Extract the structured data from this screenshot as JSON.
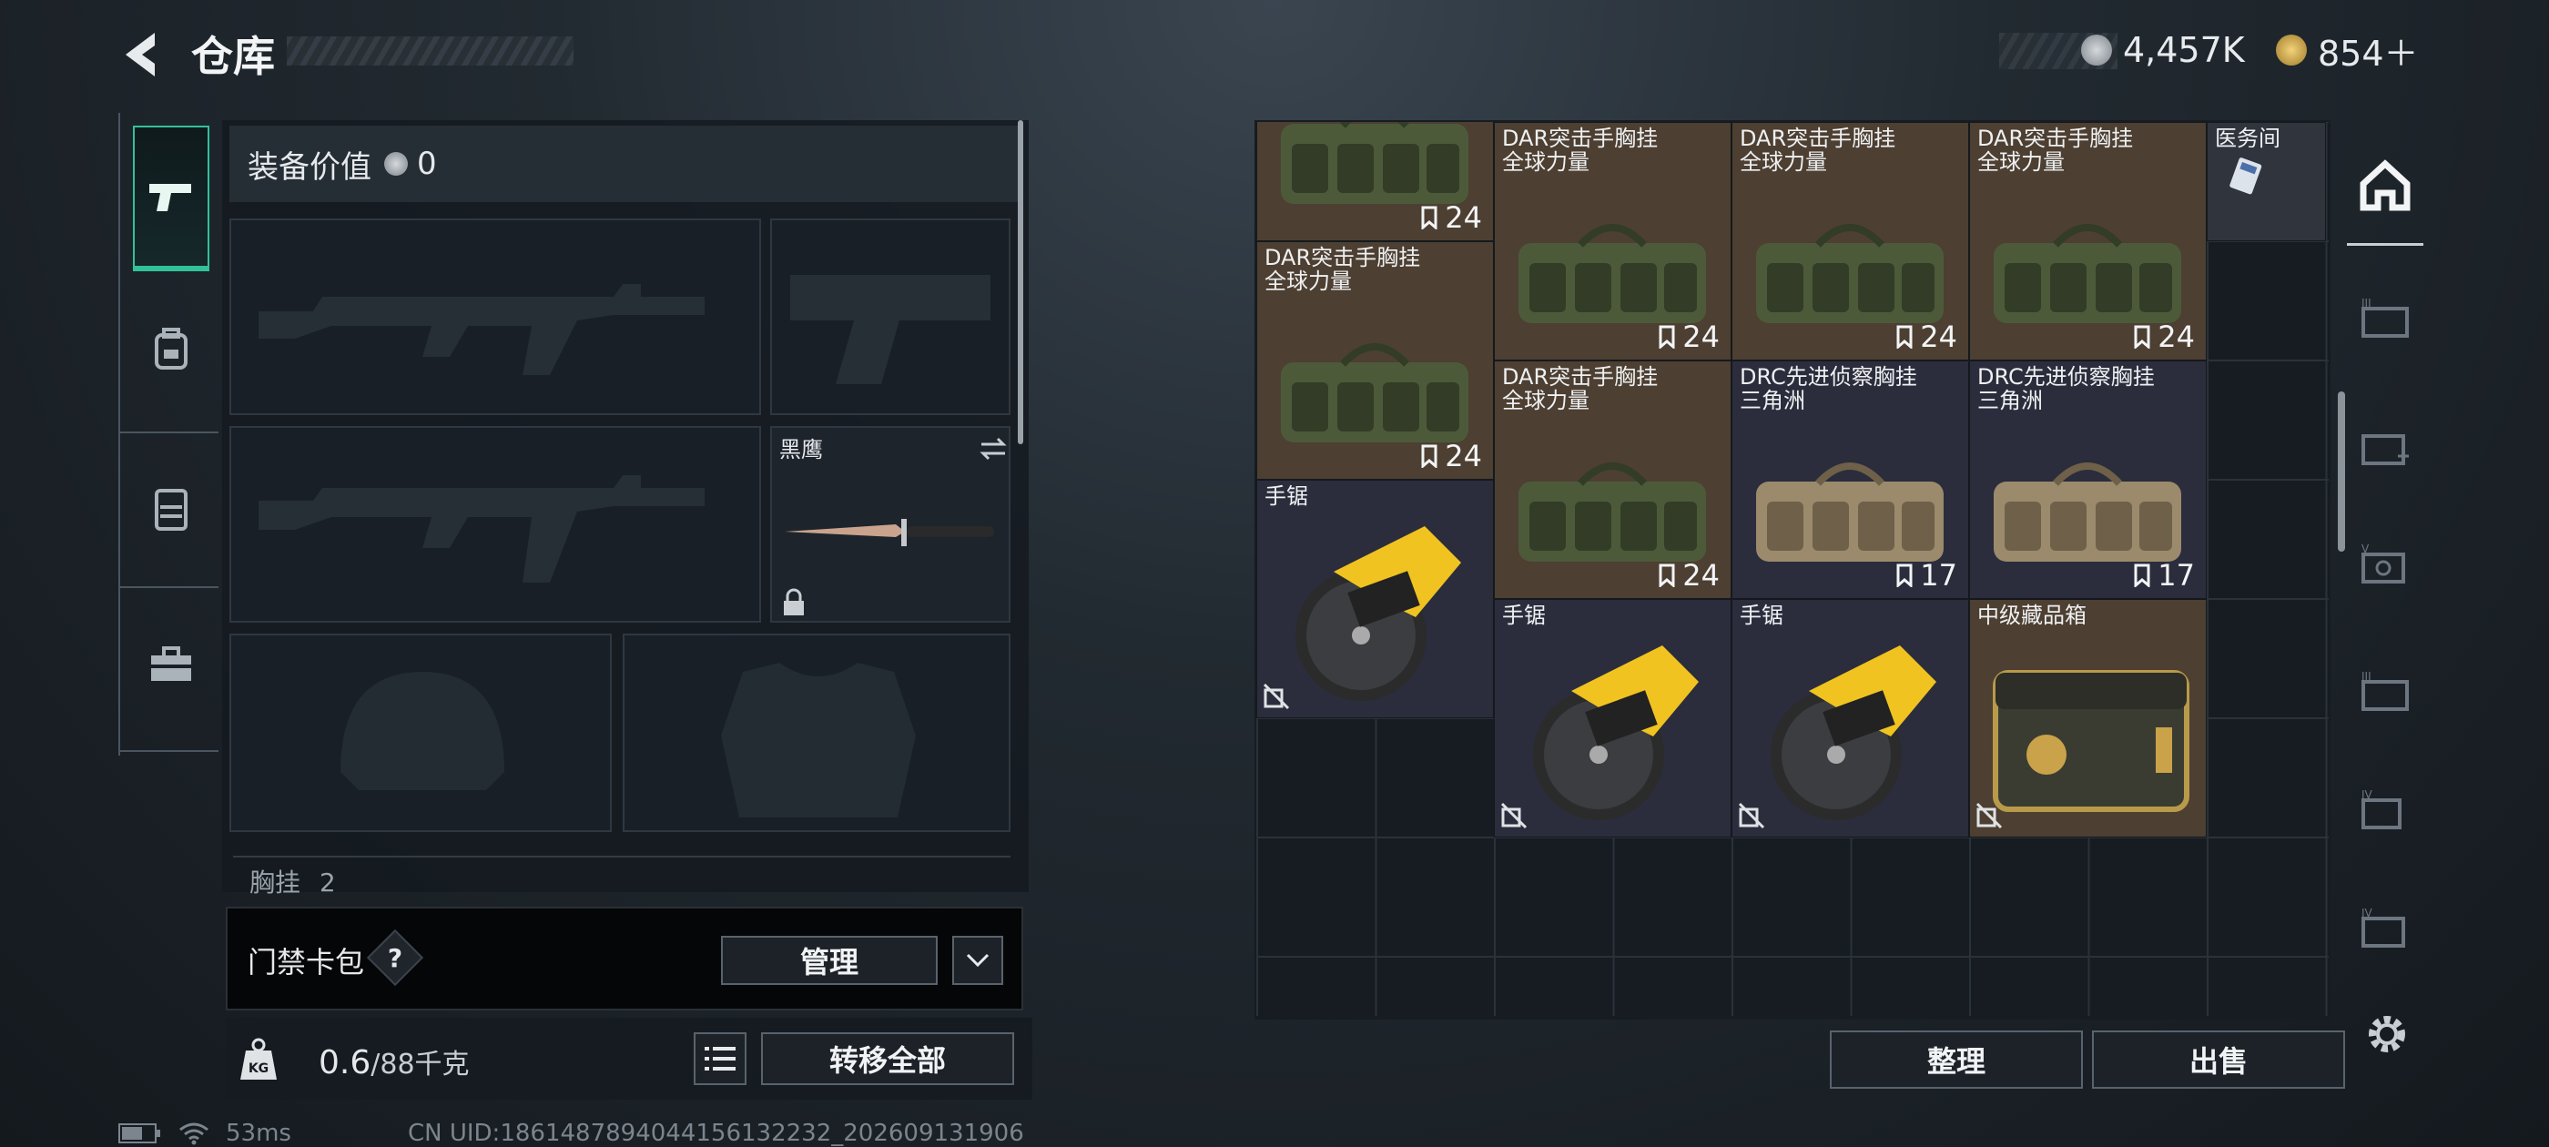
{
  "header": {
    "title": "仓库",
    "currency_silver": "4,457K",
    "currency_gold": "854＋"
  },
  "equipment": {
    "value_label": "装备价值",
    "value": "0",
    "knife_label": "黑鹰",
    "chest_label": "胸挂",
    "chest_count": "2"
  },
  "access_card": {
    "label": "门禁卡包",
    "help": "?",
    "manage_button": "管理"
  },
  "weight": {
    "current": "0.6",
    "max": "/88千克",
    "transfer_all": "转移全部"
  },
  "status": {
    "ping": "53ms",
    "uid": "CN UID:1861487894044156132232_202609131906"
  },
  "grid": {
    "items": [
      {
        "name": "",
        "count": "24",
        "kind": "bag",
        "color": "brown"
      },
      {
        "name": "DAR突击手胸挂\n全球力量",
        "count": "24",
        "kind": "bag",
        "color": "brown"
      },
      {
        "name": "DAR突击手胸挂\n全球力量",
        "count": "24",
        "kind": "bag",
        "color": "brown"
      },
      {
        "name": "DAR突击手胸挂\n全球力量",
        "count": "24",
        "kind": "bag",
        "color": "brown"
      },
      {
        "name": "医务间",
        "count": "",
        "kind": "key",
        "color": "grey"
      },
      {
        "name": "DAR突击手胸挂\n全球力量",
        "count": "24",
        "kind": "bag",
        "color": "brown"
      },
      {
        "name": "DAR突击手胸挂\n全球力量",
        "count": "24",
        "kind": "bag",
        "color": "brown"
      },
      {
        "name": "DRC先进侦察胸挂\n三角洲",
        "count": "17",
        "kind": "tanbag",
        "color": "blue"
      },
      {
        "name": "DRC先进侦察胸挂\n三角洲",
        "count": "17",
        "kind": "tanbag",
        "color": "blue"
      },
      {
        "name": "手锯",
        "count": "",
        "kind": "saw",
        "color": "blue"
      },
      {
        "name": "手锯",
        "count": "",
        "kind": "saw",
        "color": "blue"
      },
      {
        "name": "手锯",
        "count": "",
        "kind": "saw",
        "color": "blue"
      },
      {
        "name": "中级藏品箱",
        "count": "",
        "kind": "case",
        "color": "brown"
      }
    ],
    "top_counts": [
      "24",
      "24",
      "24"
    ],
    "sort_button": "整理",
    "sell_button": "出售"
  },
  "colors": {
    "accent": "#32c29a",
    "brown_cell": "#4d3f31",
    "blue_cell": "#2b2d3c"
  }
}
